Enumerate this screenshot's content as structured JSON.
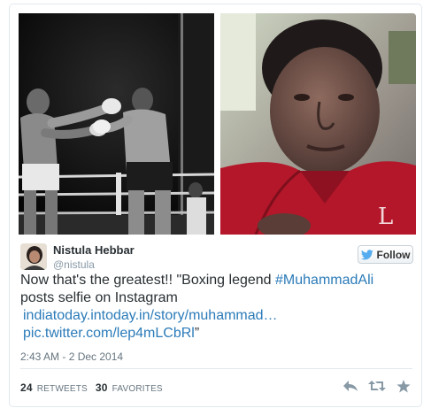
{
  "author": {
    "name": "Nistula Hebbar",
    "handle": "@nistula"
  },
  "follow_label": "Follow",
  "tweet": {
    "text_before": "Now that's the greatest!! \"Boxing legend ",
    "hashtag": "#MuhammadAli",
    "text_line2": "posts selfie on Instagram",
    "link1": "indiatoday.intoday.in/story/muhammad…",
    "link2": "pic.twitter.com/lep4mLCbRl",
    "closing_quote": "”"
  },
  "timestamp": "2:43 AM - 2 Dec 2014",
  "stats": {
    "retweets_count": "24",
    "retweets_label": "RETWEETS",
    "favorites_count": "30",
    "favorites_label": "FAVORITES"
  },
  "icons": {
    "follow": "twitter-bird-icon",
    "reply": "reply-icon",
    "retweet": "retweet-icon",
    "favorite": "star-icon"
  },
  "colors": {
    "link": "#2b7bb9",
    "text": "#292f33",
    "muted": "#8899a6",
    "brand": "#55acee"
  }
}
